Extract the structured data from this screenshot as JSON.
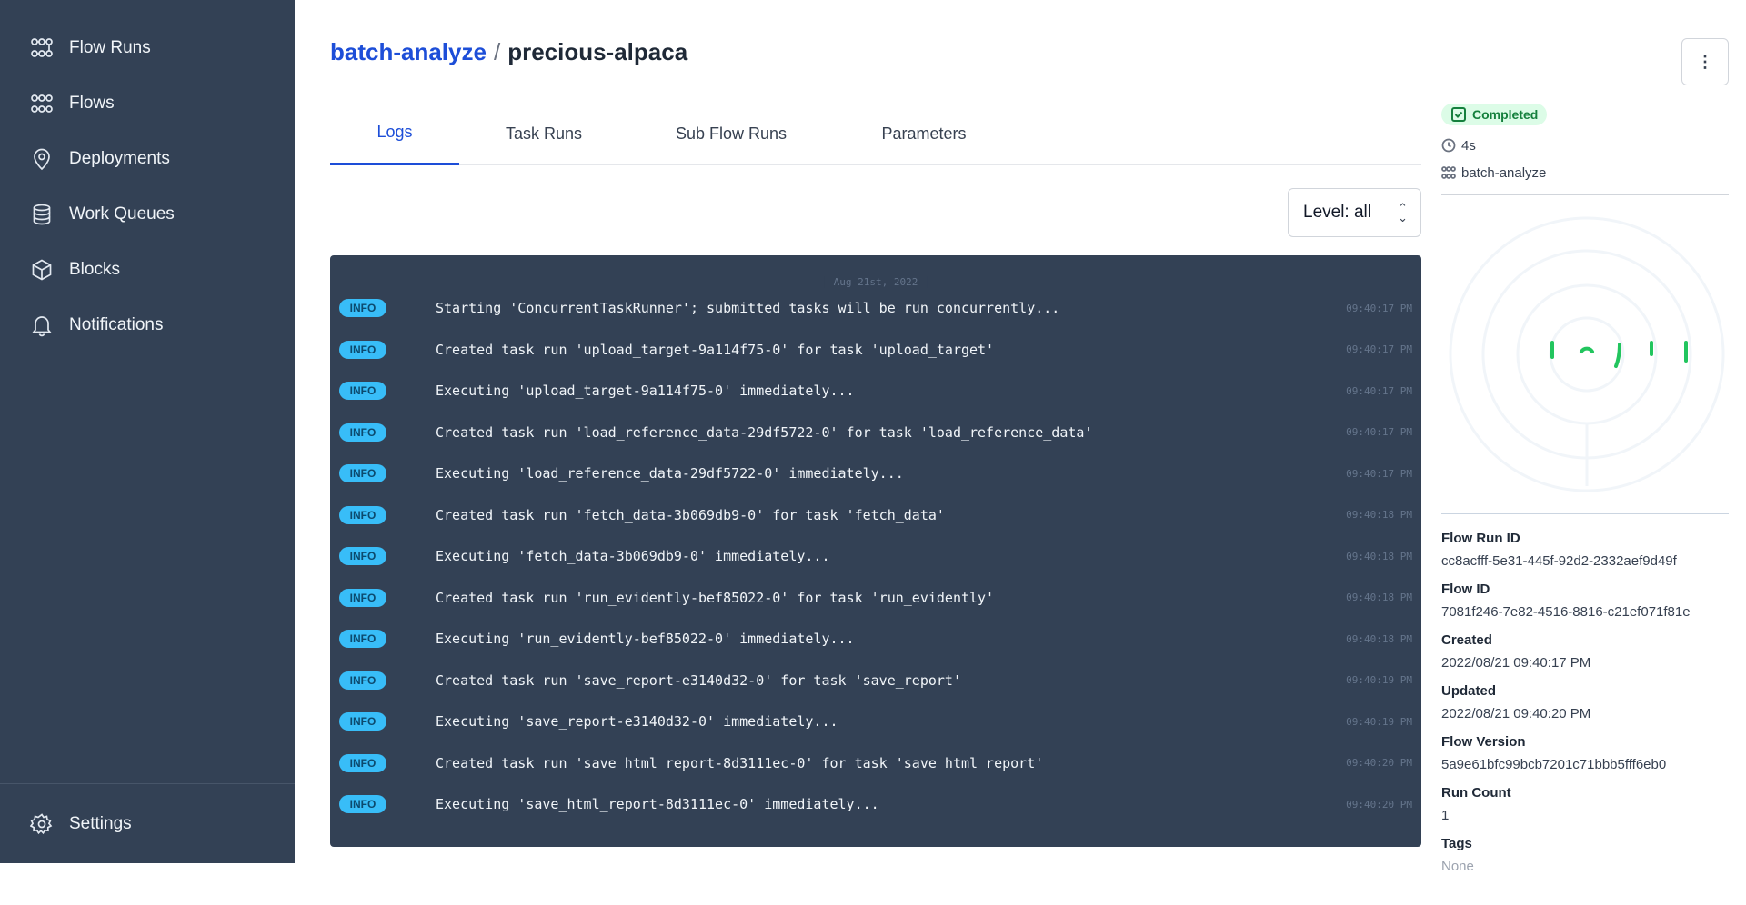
{
  "sidebar": {
    "items": [
      {
        "label": "Flow Runs",
        "icon": "flow-runs-icon"
      },
      {
        "label": "Flows",
        "icon": "flows-icon"
      },
      {
        "label": "Deployments",
        "icon": "deployments-icon"
      },
      {
        "label": "Work Queues",
        "icon": "work-queues-icon"
      },
      {
        "label": "Blocks",
        "icon": "blocks-icon"
      },
      {
        "label": "Notifications",
        "icon": "bell-icon"
      }
    ],
    "settings": {
      "label": "Settings",
      "icon": "gear-icon"
    }
  },
  "breadcrumb": {
    "flow": "batch-analyze",
    "separator": "/",
    "run": "precious-alpaca"
  },
  "tabs": [
    {
      "label": "Logs",
      "active": true
    },
    {
      "label": "Task Runs",
      "active": false
    },
    {
      "label": "Sub Flow Runs",
      "active": false
    },
    {
      "label": "Parameters",
      "active": false
    }
  ],
  "level_filter": {
    "label": "Level: all"
  },
  "logs": {
    "date": "Aug 21st, 2022",
    "entries": [
      {
        "level": "INFO",
        "message": "Starting 'ConcurrentTaskRunner'; submitted tasks will be run concurrently...",
        "time": "09:40:17 PM"
      },
      {
        "level": "INFO",
        "message": "Created task run 'upload_target-9a114f75-0' for task 'upload_target'",
        "time": "09:40:17 PM"
      },
      {
        "level": "INFO",
        "message": "Executing 'upload_target-9a114f75-0' immediately...",
        "time": "09:40:17 PM"
      },
      {
        "level": "INFO",
        "message": "Created task run 'load_reference_data-29df5722-0' for task 'load_reference_data'",
        "time": "09:40:17 PM"
      },
      {
        "level": "INFO",
        "message": "Executing 'load_reference_data-29df5722-0' immediately...",
        "time": "09:40:17 PM"
      },
      {
        "level": "INFO",
        "message": "Created task run 'fetch_data-3b069db9-0' for task 'fetch_data'",
        "time": "09:40:18 PM"
      },
      {
        "level": "INFO",
        "message": "Executing 'fetch_data-3b069db9-0' immediately...",
        "time": "09:40:18 PM"
      },
      {
        "level": "INFO",
        "message": "Created task run 'run_evidently-bef85022-0' for task 'run_evidently'",
        "time": "09:40:18 PM"
      },
      {
        "level": "INFO",
        "message": "Executing 'run_evidently-bef85022-0' immediately...",
        "time": "09:40:18 PM"
      },
      {
        "level": "INFO",
        "message": "Created task run 'save_report-e3140d32-0' for task 'save_report'",
        "time": "09:40:19 PM"
      },
      {
        "level": "INFO",
        "message": "Executing 'save_report-e3140d32-0' immediately...",
        "time": "09:40:19 PM"
      },
      {
        "level": "INFO",
        "message": "Created task run 'save_html_report-8d3111ec-0' for task 'save_html_report'",
        "time": "09:40:20 PM"
      },
      {
        "level": "INFO",
        "message": "Executing 'save_html_report-8d3111ec-0' immediately...",
        "time": "09:40:20 PM"
      }
    ]
  },
  "run_panel": {
    "status": "Completed",
    "duration": "4s",
    "flow_name": "batch-analyze",
    "details": [
      {
        "label": "Flow Run ID",
        "value": "cc8acfff-5e31-445f-92d2-2332aef9d49f"
      },
      {
        "label": "Flow ID",
        "value": "7081f246-7e82-4516-8816-c21ef071f81e"
      },
      {
        "label": "Created",
        "value": "2022/08/21 09:40:17 PM"
      },
      {
        "label": "Updated",
        "value": "2022/08/21 09:40:20 PM"
      },
      {
        "label": "Flow Version",
        "value": "5a9e61bfc99bcb7201c71bbb5fff6eb0"
      },
      {
        "label": "Run Count",
        "value": "1"
      },
      {
        "label": "Tags",
        "value": "None"
      }
    ]
  },
  "colors": {
    "sidebar_bg": "#334155",
    "accent": "#1d4ed8",
    "log_bg": "#334155",
    "info_badge": "#38bdf8",
    "completed": "#22c55e"
  }
}
